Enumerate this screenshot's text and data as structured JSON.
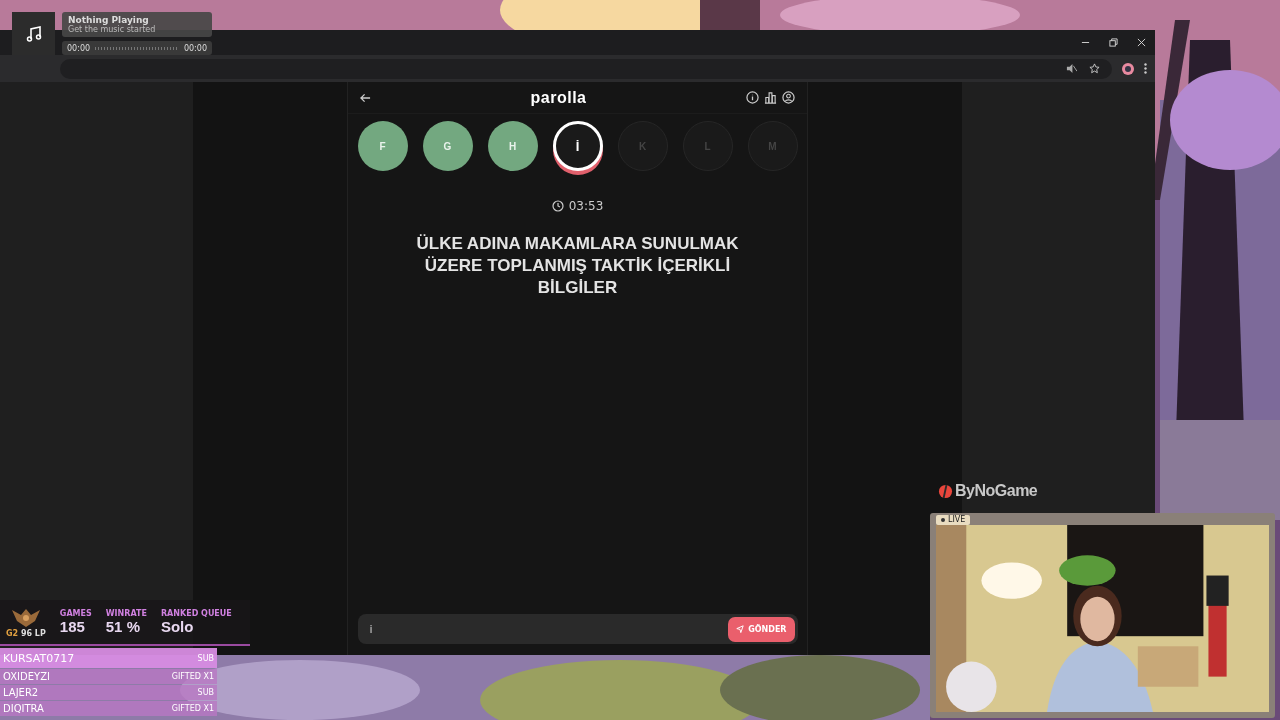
{
  "music_widget": {
    "title": "Nothing Playing",
    "subtitle": "Get the music started",
    "elapsed": "00:00",
    "duration": "00:00"
  },
  "game": {
    "title": "parolla",
    "letters": [
      {
        "letter": "F",
        "kind": "answered"
      },
      {
        "letter": "G",
        "kind": "answered"
      },
      {
        "letter": "H",
        "kind": "answered"
      },
      {
        "letter": "İ",
        "kind": "current"
      },
      {
        "letter": "K",
        "kind": "upcoming"
      },
      {
        "letter": "L",
        "kind": "upcoming"
      },
      {
        "letter": "M",
        "kind": "upcoming"
      }
    ],
    "timer": "03:53",
    "question": "ÜLKE ADINA MAKAMLARA SUNULMAK ÜZERE TOPLANMIŞ TAKTİK İÇERİKLİ BİLGİLER",
    "answer": "i",
    "submit": "GÖNDER"
  },
  "sponsor": "ByNoGame",
  "webcam": {
    "badge": "LIVE"
  },
  "rank_stats": {
    "tier": "G2",
    "lp": "96 LP",
    "stats": [
      {
        "label": "GAMES",
        "value": "185"
      },
      {
        "label": "WINRATE",
        "value": "51 %"
      },
      {
        "label": "RANKED QUEUE",
        "value": "Solo"
      }
    ]
  },
  "events": [
    {
      "name": "KURSAT0717",
      "tag": "SUB",
      "selected": true
    },
    {
      "name": "OXIDEYZI",
      "tag": "GIFTED X1",
      "selected": false
    },
    {
      "name": "LAJER2",
      "tag": "SUB",
      "selected": false
    },
    {
      "name": "DIQITRA",
      "tag": "GIFTED X1",
      "selected": false
    }
  ]
}
